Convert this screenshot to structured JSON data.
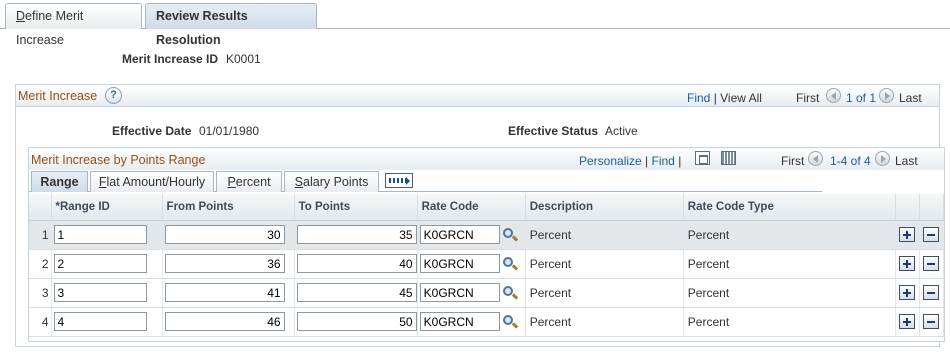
{
  "page_tabs": [
    {
      "label_first": "D",
      "label_rest": "efine Merit Increase"
    },
    {
      "label": "Review Results Resolution"
    }
  ],
  "merit_increase_id": {
    "label": "Merit Increase ID",
    "value": "K0001"
  },
  "merit_increase": {
    "title": "Merit Increase",
    "find": "Find",
    "view_all": "View All",
    "first": "First",
    "count": "1 of 1",
    "last": "Last",
    "effective_date_label": "Effective Date",
    "effective_date": "01/01/1980",
    "effective_status_label": "Effective Status",
    "effective_status": "Active"
  },
  "grid": {
    "title": "Merit Increase by Points Range",
    "personalize": "Personalize",
    "find": "Find",
    "first": "First",
    "count": "1-4 of 4",
    "last": "Last",
    "tabs": [
      {
        "label": "Range"
      },
      {
        "u": "F",
        "rest": "lat Amount/Hourly"
      },
      {
        "u": "P",
        "rest": "ercent"
      },
      {
        "u": "S",
        "rest": "alary Points"
      }
    ],
    "columns": [
      "*Range ID",
      "From Points",
      "To Points",
      "Rate Code",
      "Description",
      "Rate Code Type"
    ],
    "rows": [
      {
        "num": "1",
        "range_id": "1",
        "from": "30",
        "to": "35",
        "rate_code": "K0GRCN",
        "description": "Percent",
        "type": "Percent"
      },
      {
        "num": "2",
        "range_id": "2",
        "from": "36",
        "to": "40",
        "rate_code": "K0GRCN",
        "description": "Percent",
        "type": "Percent"
      },
      {
        "num": "3",
        "range_id": "3",
        "from": "41",
        "to": "45",
        "rate_code": "K0GRCN",
        "description": "Percent",
        "type": "Percent"
      },
      {
        "num": "4",
        "range_id": "4",
        "from": "46",
        "to": "50",
        "rate_code": "K0GRCN",
        "description": "Percent",
        "type": "Percent"
      }
    ]
  }
}
